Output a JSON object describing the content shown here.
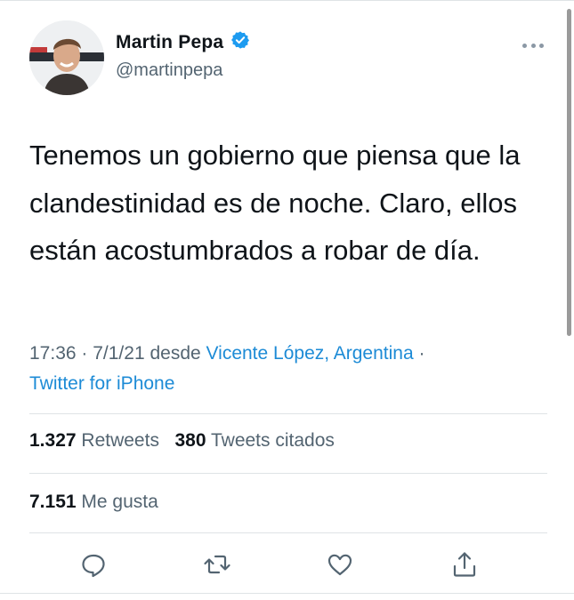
{
  "author": {
    "name": "Martin Pepa",
    "handle": "@martinpepa",
    "verified": true
  },
  "tweet": {
    "text": "Tenemos un gobierno que piensa que la clandestinidad es de noche. Claro, ellos están acostumbrados a robar de día."
  },
  "meta": {
    "time": "17:36",
    "date": "7/1/21",
    "desde": "desde",
    "location": "Vicente López, Argentina",
    "source": "Twitter for iPhone"
  },
  "stats": {
    "retweets_count": "1.327",
    "retweets_label": "Retweets",
    "quotes_count": "380",
    "quotes_label": "Tweets citados",
    "likes_count": "7.151",
    "likes_label": "Me gusta"
  },
  "actions": [
    "reply-icon",
    "retweet-icon",
    "like-icon",
    "share-icon"
  ],
  "colors": {
    "link": "#1d8bd6",
    "secondary_text": "#536471",
    "verified": "#1d9bf0"
  }
}
